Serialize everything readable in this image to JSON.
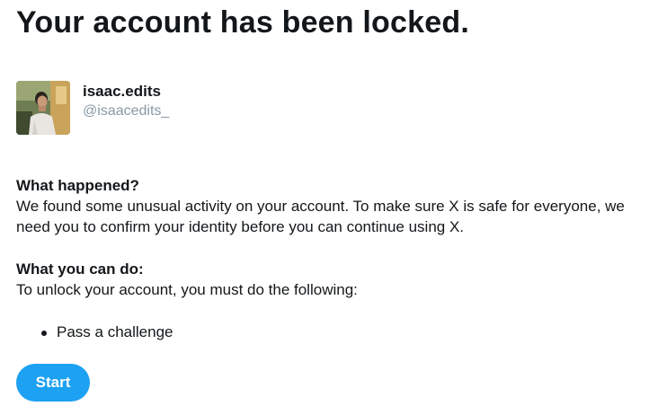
{
  "page": {
    "title": "Your account has been locked."
  },
  "profile": {
    "display_name": "isaac.edits",
    "handle": "@isaacedits_",
    "avatar_icon": "user-photo"
  },
  "what_happened": {
    "heading": "What happened?",
    "body_line1": "We found some unusual activity on your account. To make sure X is safe for everyone, we",
    "body_line2": "need you to confirm your identity before you can continue using X."
  },
  "what_you_can_do": {
    "heading": "What you can do:",
    "body": "To unlock your account, you must do the following:",
    "steps": [
      "Pass a challenge"
    ]
  },
  "actions": {
    "start_label": "Start"
  },
  "colors": {
    "accent": "#1da1f2",
    "text": "#14171a",
    "muted": "#8899a6"
  }
}
